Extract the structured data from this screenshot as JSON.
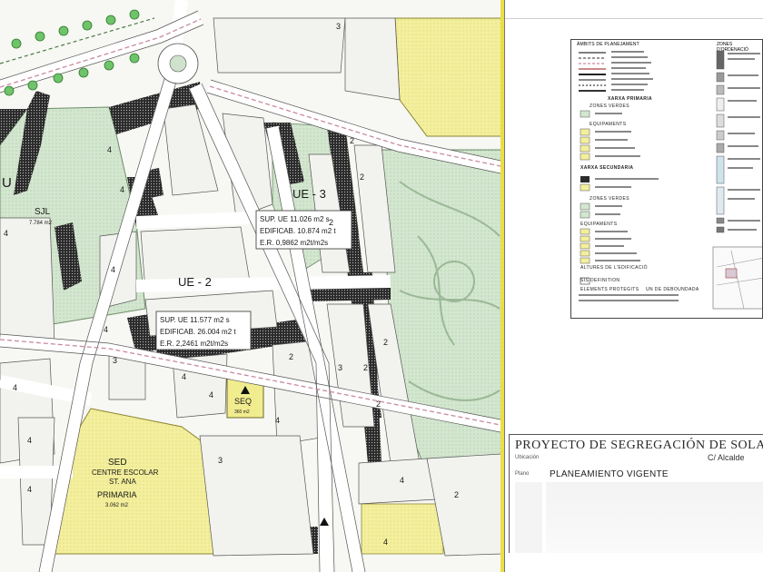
{
  "map": {
    "zones": {
      "ue3": "UE - 3",
      "ue2": "UE - 2",
      "u": "U",
      "sjl": "SJL",
      "sjl_area": "7.784 m2",
      "seq_small": "SEQ",
      "seq_small_area": "360 m2",
      "seq_school": "SED",
      "school_name1": "CENTRE ESCOLAR",
      "school_name2": "ST. ANA",
      "school_name3": "PRIMARIA",
      "school_area": "3.062 m2"
    },
    "ue3_box": {
      "sup": "SUP. UE    11.026 m2 s",
      "edif": "EDIFICAB. 10.874 m2 t",
      "er": "E.R.       0,9862 m2t/m2s"
    },
    "ue2_box": {
      "sup": "SUP. UE    11.577 m2 s",
      "edif": "EDIFICAB. 26.004 m2 t",
      "er": "E.R.       2,2461 m2t/m2s"
    },
    "heights": [
      "4",
      "3",
      "4",
      "2",
      "2",
      "2",
      "4",
      "4",
      "4",
      "3",
      "2",
      "2",
      "4",
      "4",
      "2",
      "4",
      "3",
      "2",
      "4",
      "4",
      "4",
      "3",
      "4",
      "2",
      "4"
    ]
  },
  "legend": {
    "header_left": "ÀMBITS DE PLANEJAMENT",
    "header_right": "ZONES D'ORDENACIÓ",
    "section_xarxa_primaria": "XARXA PRIMARIA",
    "section_zones_verdes": "ZONES VERDES",
    "section_equipaments": "EQUIPAMENTS",
    "section_xarxa_secundaria": "XARXA SECUNDARIA",
    "section_zones_verdes2": "ZONES VERDES",
    "section_equipaments2": "EQUIPAMENTS",
    "section_altures": "ALTURES DE L'EDIFICACIÓ",
    "section_elements": "ELEMENTS PROTEGITS",
    "section_bic": "UN DE DEBOUNDADA",
    "section_sis": "SIS DEFINITION"
  },
  "title_block": {
    "title": "PROYECTO DE SEGREGACIÓN DE SOLA",
    "ubicacion_label": "Ubicación",
    "ubicacion": "C/ Alcalde",
    "plano_label": "Plano",
    "plano": "PLANEAMIENTO VIGENTE"
  },
  "colors": {
    "green_zone": "#cfe2cc",
    "yellow_zone": "#f2ee9a",
    "road": "#ffffff",
    "block": "#f4f4ef",
    "pattern_dark": "#222222"
  }
}
